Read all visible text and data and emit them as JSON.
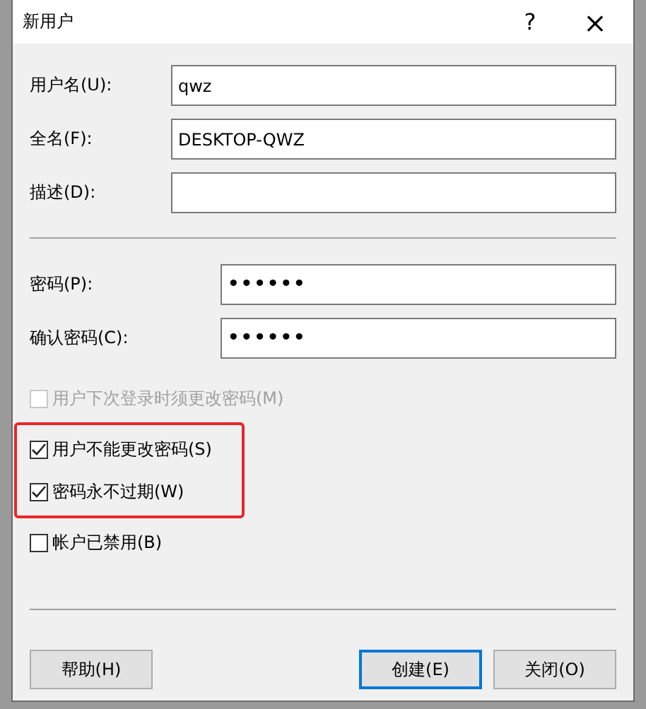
{
  "window": {
    "title": "新用户",
    "help": "?",
    "close": "×"
  },
  "account_fields": [
    {
      "label": "用户名(U):",
      "value": "qwz"
    },
    {
      "label": "全名(F):",
      "value": "DESKTOP-QWZ"
    },
    {
      "label": "描述(D):"
    }
  ],
  "password_fields": [
    {
      "label": "密码(P):",
      "value": "••••••"
    },
    {
      "label": "确认密码(C):",
      "value": "••••••"
    }
  ],
  "options": [
    {
      "label": "用户下次登录时须更改密码(M)",
      "checked": false,
      "disabled": true,
      "highlighted": false
    },
    {
      "label": "用户不能更改密码(S)",
      "checked": true,
      "disabled": false,
      "highlighted": true
    },
    {
      "label": "密码永不过期(W)",
      "checked": true,
      "disabled": false,
      "highlighted": true
    },
    {
      "label": "帐户已禁用(B)",
      "checked": false,
      "disabled": false,
      "highlighted": false
    }
  ],
  "buttons": [
    {
      "label": "帮助(H)",
      "default": false
    },
    {
      "label": "创建(E)",
      "default": true
    },
    {
      "label": "关闭(O)",
      "default": false
    }
  ]
}
